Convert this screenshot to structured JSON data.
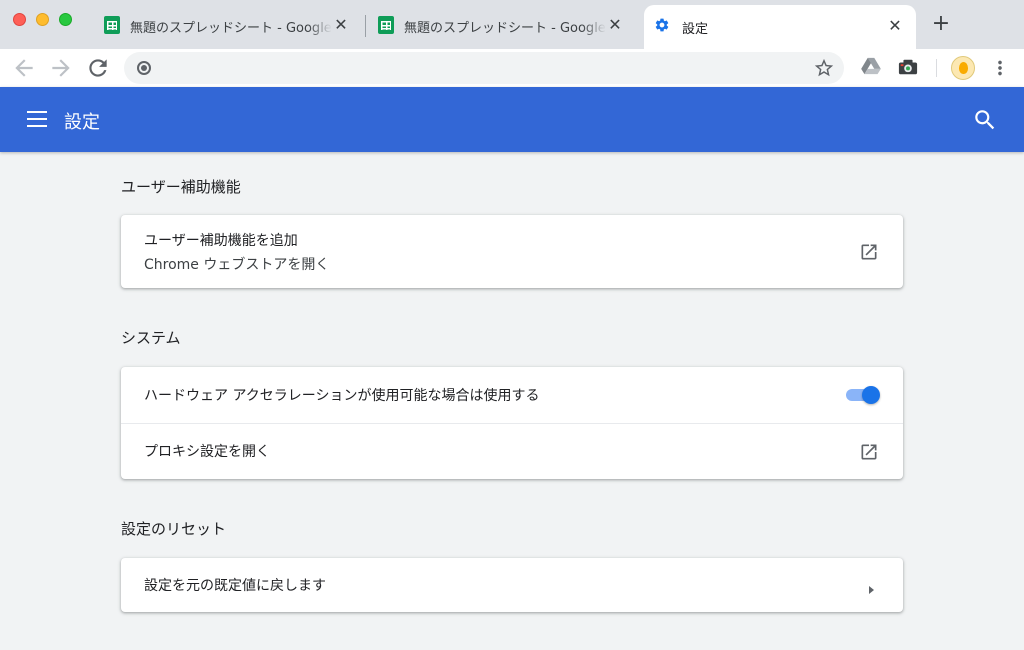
{
  "tabs": [
    {
      "title": "無題のスプレッドシート - Google",
      "icon": "sheets-icon",
      "active": false
    },
    {
      "title": "無題のスプレッドシート - Google",
      "icon": "sheets-icon",
      "active": false
    },
    {
      "title": "設定",
      "icon": "gear-icon",
      "active": true
    }
  ],
  "toolbar": {
    "omnibox_value": "",
    "omnibox_placeholder": ""
  },
  "header": {
    "title": "設定"
  },
  "sections": {
    "accessibility": {
      "title": "ユーザー補助機能",
      "row_title": "ユーザー補助機能を追加",
      "row_subtitle": "Chrome ウェブストアを開く"
    },
    "system": {
      "title": "システム",
      "hw_accel_label": "ハードウェア アクセラレーションが使用可能な場合は使用する",
      "hw_accel_enabled": true,
      "proxy_label": "プロキシ設定を開く"
    },
    "reset": {
      "title": "設定のリセット",
      "reset_label": "設定を元の既定値に戻します"
    }
  },
  "colors": {
    "header_bg": "#3367d6",
    "toggle_on": "#1a73e8",
    "page_bg": "#f1f3f4"
  }
}
